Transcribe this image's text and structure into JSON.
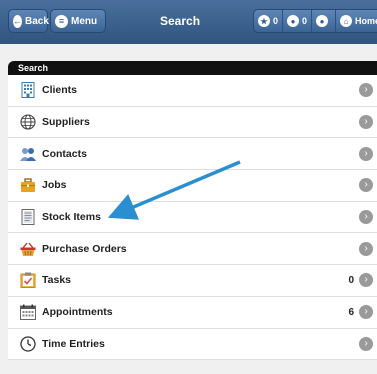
{
  "header": {
    "back_label": "Back",
    "menu_label": "Menu",
    "title": "Search",
    "favorites_count": "0",
    "users_count": "0",
    "home_label": "Home"
  },
  "panel": {
    "title": "Search",
    "items": [
      {
        "label": "Clients",
        "icon": "building-icon",
        "count": ""
      },
      {
        "label": "Suppliers",
        "icon": "globe-icon",
        "count": ""
      },
      {
        "label": "Contacts",
        "icon": "contacts-icon",
        "count": ""
      },
      {
        "label": "Jobs",
        "icon": "briefcase-icon",
        "count": ""
      },
      {
        "label": "Stock Items",
        "icon": "document-icon",
        "count": ""
      },
      {
        "label": "Purchase Orders",
        "icon": "basket-icon",
        "count": ""
      },
      {
        "label": "Tasks",
        "icon": "clipboard-check-icon",
        "count": "0"
      },
      {
        "label": "Appointments",
        "icon": "calendar-icon",
        "count": "6"
      },
      {
        "label": "Time Entries",
        "icon": "clock-icon",
        "count": ""
      }
    ]
  },
  "colors": {
    "header": "#3a6494",
    "arrow": "#2a8fd0"
  }
}
